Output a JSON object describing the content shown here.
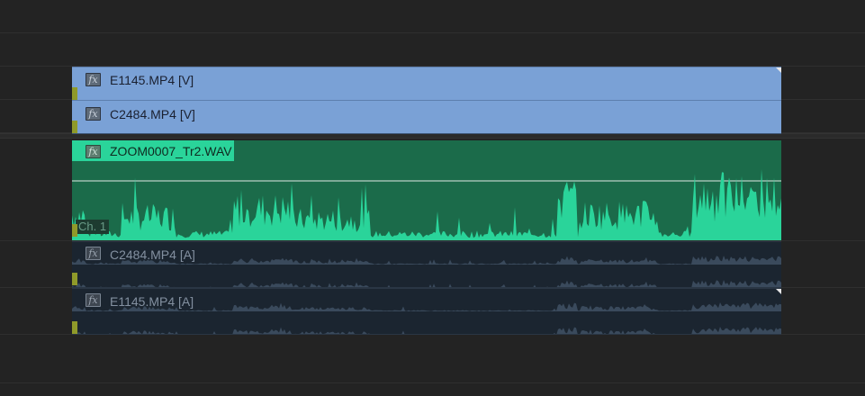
{
  "tracks": [
    {
      "kind": "video",
      "clip": "E1145.MP4 [V]",
      "fx": "fx"
    },
    {
      "kind": "video",
      "clip": "C2484.MP4 [V]",
      "fx": "fx"
    },
    {
      "kind": "audio",
      "clip": "ZOOM0007_Tr2.WAV",
      "fx": "fx",
      "channel": "Ch. 1"
    },
    {
      "kind": "audio",
      "clip": "C2484.MP4 [A]",
      "fx": "fx"
    },
    {
      "kind": "audio",
      "clip": "E1145.MP4 [A]",
      "fx": "fx"
    }
  ],
  "colors": {
    "video_clip": "#7aa1d6",
    "audio_clip": "#1b6b4a",
    "waveform": "#2ad49a",
    "muted_clip": "#1b2530",
    "muted_waveform": "#3a4a5c"
  }
}
